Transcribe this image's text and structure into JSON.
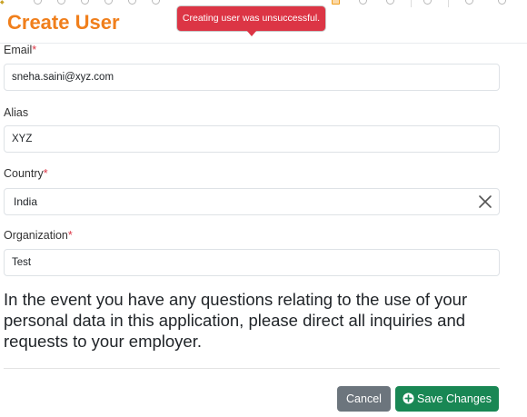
{
  "page": {
    "title": "Create User"
  },
  "toast": {
    "message": "Creating user was unsuccessful.",
    "color": "#dc3545"
  },
  "form": {
    "email": {
      "label": "Email",
      "required_mark": "*",
      "value": "sneha.saini@xyz.com"
    },
    "alias": {
      "label": "Alias",
      "value": "XYZ"
    },
    "country": {
      "label": "Country",
      "required_mark": "*",
      "value": "India",
      "clear_icon": "close-icon"
    },
    "organization": {
      "label": "Organization",
      "required_mark": "*",
      "value": "Test"
    }
  },
  "notice": {
    "text": "In the event you have any questions relating to the use of your personal data in this application, please direct all inquiries and requests to your employer."
  },
  "footer": {
    "cancel_label": "Cancel",
    "save_label": "Save Changes",
    "save_icon": "plus-circle-icon"
  },
  "colors": {
    "title": "#f07f1c",
    "cancel": "#6c757d",
    "save": "#198754",
    "required": "#dc3545"
  }
}
